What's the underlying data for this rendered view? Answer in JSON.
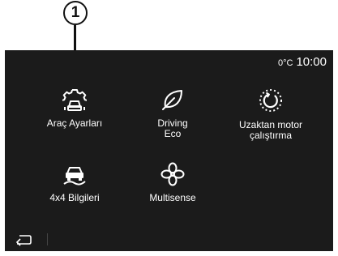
{
  "callout": {
    "number": "1"
  },
  "status": {
    "temperature": "0°C",
    "time": "10:00"
  },
  "apps": [
    {
      "label": "Araç Ayarları",
      "icon": "car-settings-icon"
    },
    {
      "label": "Driving\nEco",
      "icon": "leaf-icon"
    },
    {
      "label": "Uzaktan motor\nçalıştırma",
      "icon": "remote-start-icon"
    },
    {
      "label": "4x4 Bilgileri",
      "icon": "offroad-car-icon"
    },
    {
      "label": "Multisense",
      "icon": "multisense-icon"
    }
  ],
  "navigation": {
    "back_icon": "back-arrow-icon"
  },
  "colors": {
    "screen_background": "#1b1b1b",
    "text": "#ffffff"
  }
}
